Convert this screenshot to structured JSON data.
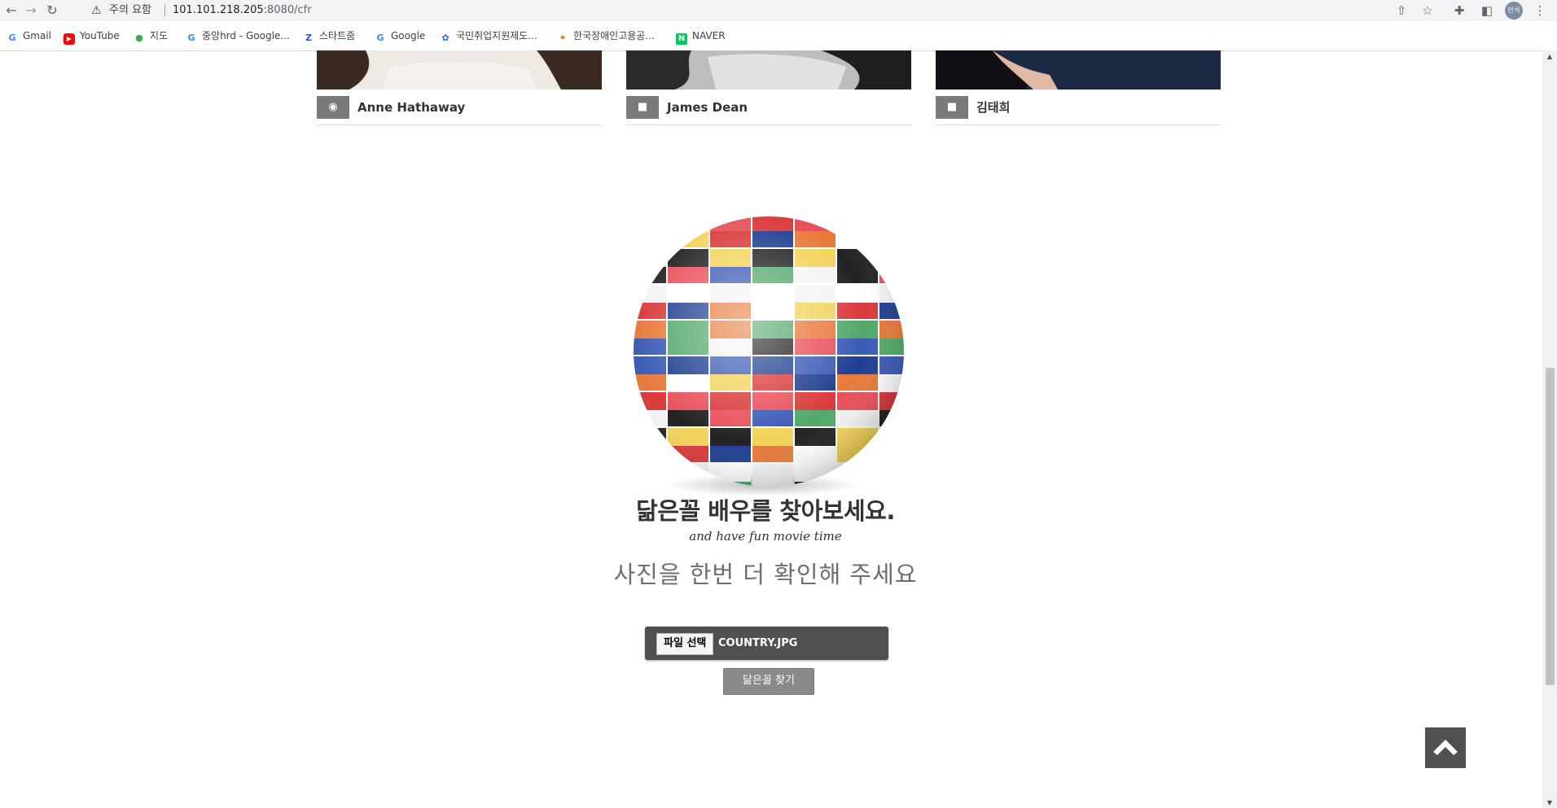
{
  "browser": {
    "back_icon": "back-arrow-icon",
    "forward_icon": "forward-arrow-icon",
    "reload_icon": "reload-icon",
    "security_warning": "주의 요함",
    "url_host": "101.101.218.205",
    "url_rest": ":8080/cfr",
    "avatar_text": "민석"
  },
  "bookmarks": [
    {
      "label": "Gmail",
      "icon": "google-icon",
      "color": "#4285f4"
    },
    {
      "label": "YouTube",
      "icon": "youtube-icon",
      "color": "#ff0000"
    },
    {
      "label": "지도",
      "icon": "maps-pin-icon",
      "color": "#34a853"
    },
    {
      "label": "중앙hrd - Google...",
      "icon": "google-icon",
      "color": "#4285f4"
    },
    {
      "label": "스타트줌",
      "icon": "z-logo-icon",
      "color": "#1a57d6"
    },
    {
      "label": "Google",
      "icon": "google-icon",
      "color": "#4285f4"
    },
    {
      "label": "국민취업지원제도...",
      "icon": "ministry-icon",
      "color": "#2d6cdf"
    },
    {
      "label": "한국장애인고용공...",
      "icon": "kead-icon",
      "color": "#e8710a"
    },
    {
      "label": "NAVER",
      "icon": "naver-icon",
      "color": "#03c75a"
    }
  ],
  "cards": [
    {
      "name": "Anne Hathaway",
      "badge_icon": "camera-icon"
    },
    {
      "name": "James Dean",
      "badge_icon": "video-camera-icon"
    },
    {
      "name": "김태희",
      "badge_icon": "video-camera-icon"
    }
  ],
  "hero": {
    "title": "닮은꼴 배우를 찾아보세요.",
    "subtitle": "and have fun movie time",
    "hint": "사진을 한번 더 확인해 주세요"
  },
  "upload": {
    "choose_label": "파일 선택",
    "file_name": "COUNTRY.JPG",
    "submit_label": "닮은꼴 찾기"
  },
  "scroll_top_icon": "chevron-up-icon",
  "colors": {
    "dark_gray": "#505050",
    "badge_gray": "#7a7a7a"
  }
}
